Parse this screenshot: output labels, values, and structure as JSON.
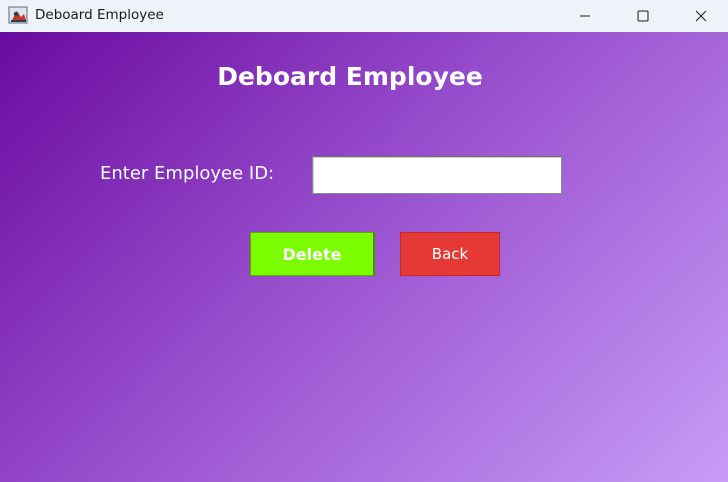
{
  "window": {
    "title": "Deboard Employee",
    "icon": "java-app-icon",
    "controls": [
      "minimize-icon",
      "maximize-icon",
      "close-icon"
    ]
  },
  "form": {
    "heading": "Deboard Employee",
    "employee_id_label": "Enter Employee ID:",
    "employee_id_value": "",
    "delete_label": "Delete",
    "back_label": "Back"
  },
  "colors": {
    "gradient_start": "#6a0aa0",
    "gradient_end": "#c89cf7",
    "delete_button": "#7cfc00",
    "back_button": "#e53935"
  }
}
